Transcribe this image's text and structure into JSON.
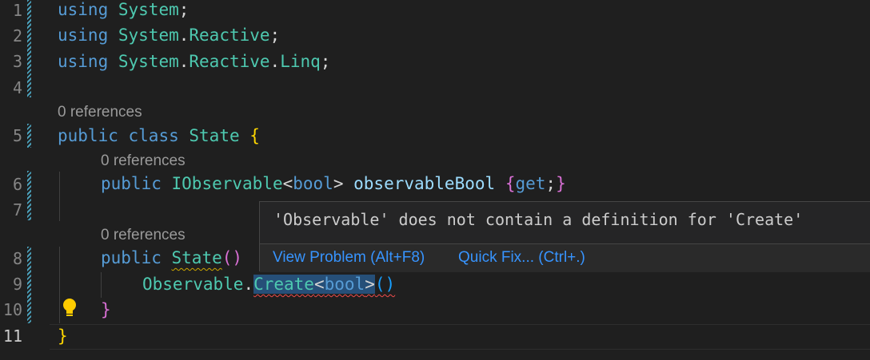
{
  "editor": {
    "line_numbers": [
      "1",
      "2",
      "3",
      "4",
      "5",
      "6",
      "7",
      "8",
      "9",
      "10",
      "11"
    ],
    "code_lens": {
      "class_state": "0 references",
      "prop_observable_bool": "0 references",
      "ctor_state": "0 references"
    },
    "lines": {
      "l1": {
        "kw": "using",
        "ns": "System",
        "semi": ";"
      },
      "l2": {
        "kw": "using",
        "ns1": "System",
        "dot": ".",
        "ns2": "Reactive",
        "semi": ";"
      },
      "l3": {
        "kw": "using",
        "ns1": "System",
        "dot1": ".",
        "ns2": "Reactive",
        "dot2": ".",
        "ns3": "Linq",
        "semi": ";"
      },
      "l5": {
        "kw1": "public",
        "kw2": "class",
        "name": "State",
        "brace": "{"
      },
      "l6": {
        "kw": "public",
        "type": "IObservable",
        "lt": "<",
        "generic": "bool",
        "gt": ">",
        "prop": "observableBool",
        "open": "{",
        "get": "get",
        "semi": ";",
        "close": "}"
      },
      "l8": {
        "kw": "public",
        "name": "State",
        "parens": "()"
      },
      "l9": {
        "type": "Observable",
        "dot": ".",
        "method": "Create",
        "lt": "<",
        "generic": "bool",
        "gt": ">",
        "parens": "()"
      },
      "l10": {
        "brace": "}"
      },
      "l11": {
        "brace": "}"
      }
    }
  },
  "hover": {
    "message": "'Observable' does not contain a definition for 'Create'",
    "view_problem": "View Problem (Alt+F8)",
    "quick_fix": "Quick Fix... (Ctrl+.)"
  },
  "icons": {
    "lightbulb": "lightbulb-icon"
  },
  "colors": {
    "background": "#1f1f1f",
    "keyword": "#569cd6",
    "type": "#4ec9b0",
    "link": "#3794ff",
    "error": "#f14c4c",
    "warning": "#cca700"
  }
}
